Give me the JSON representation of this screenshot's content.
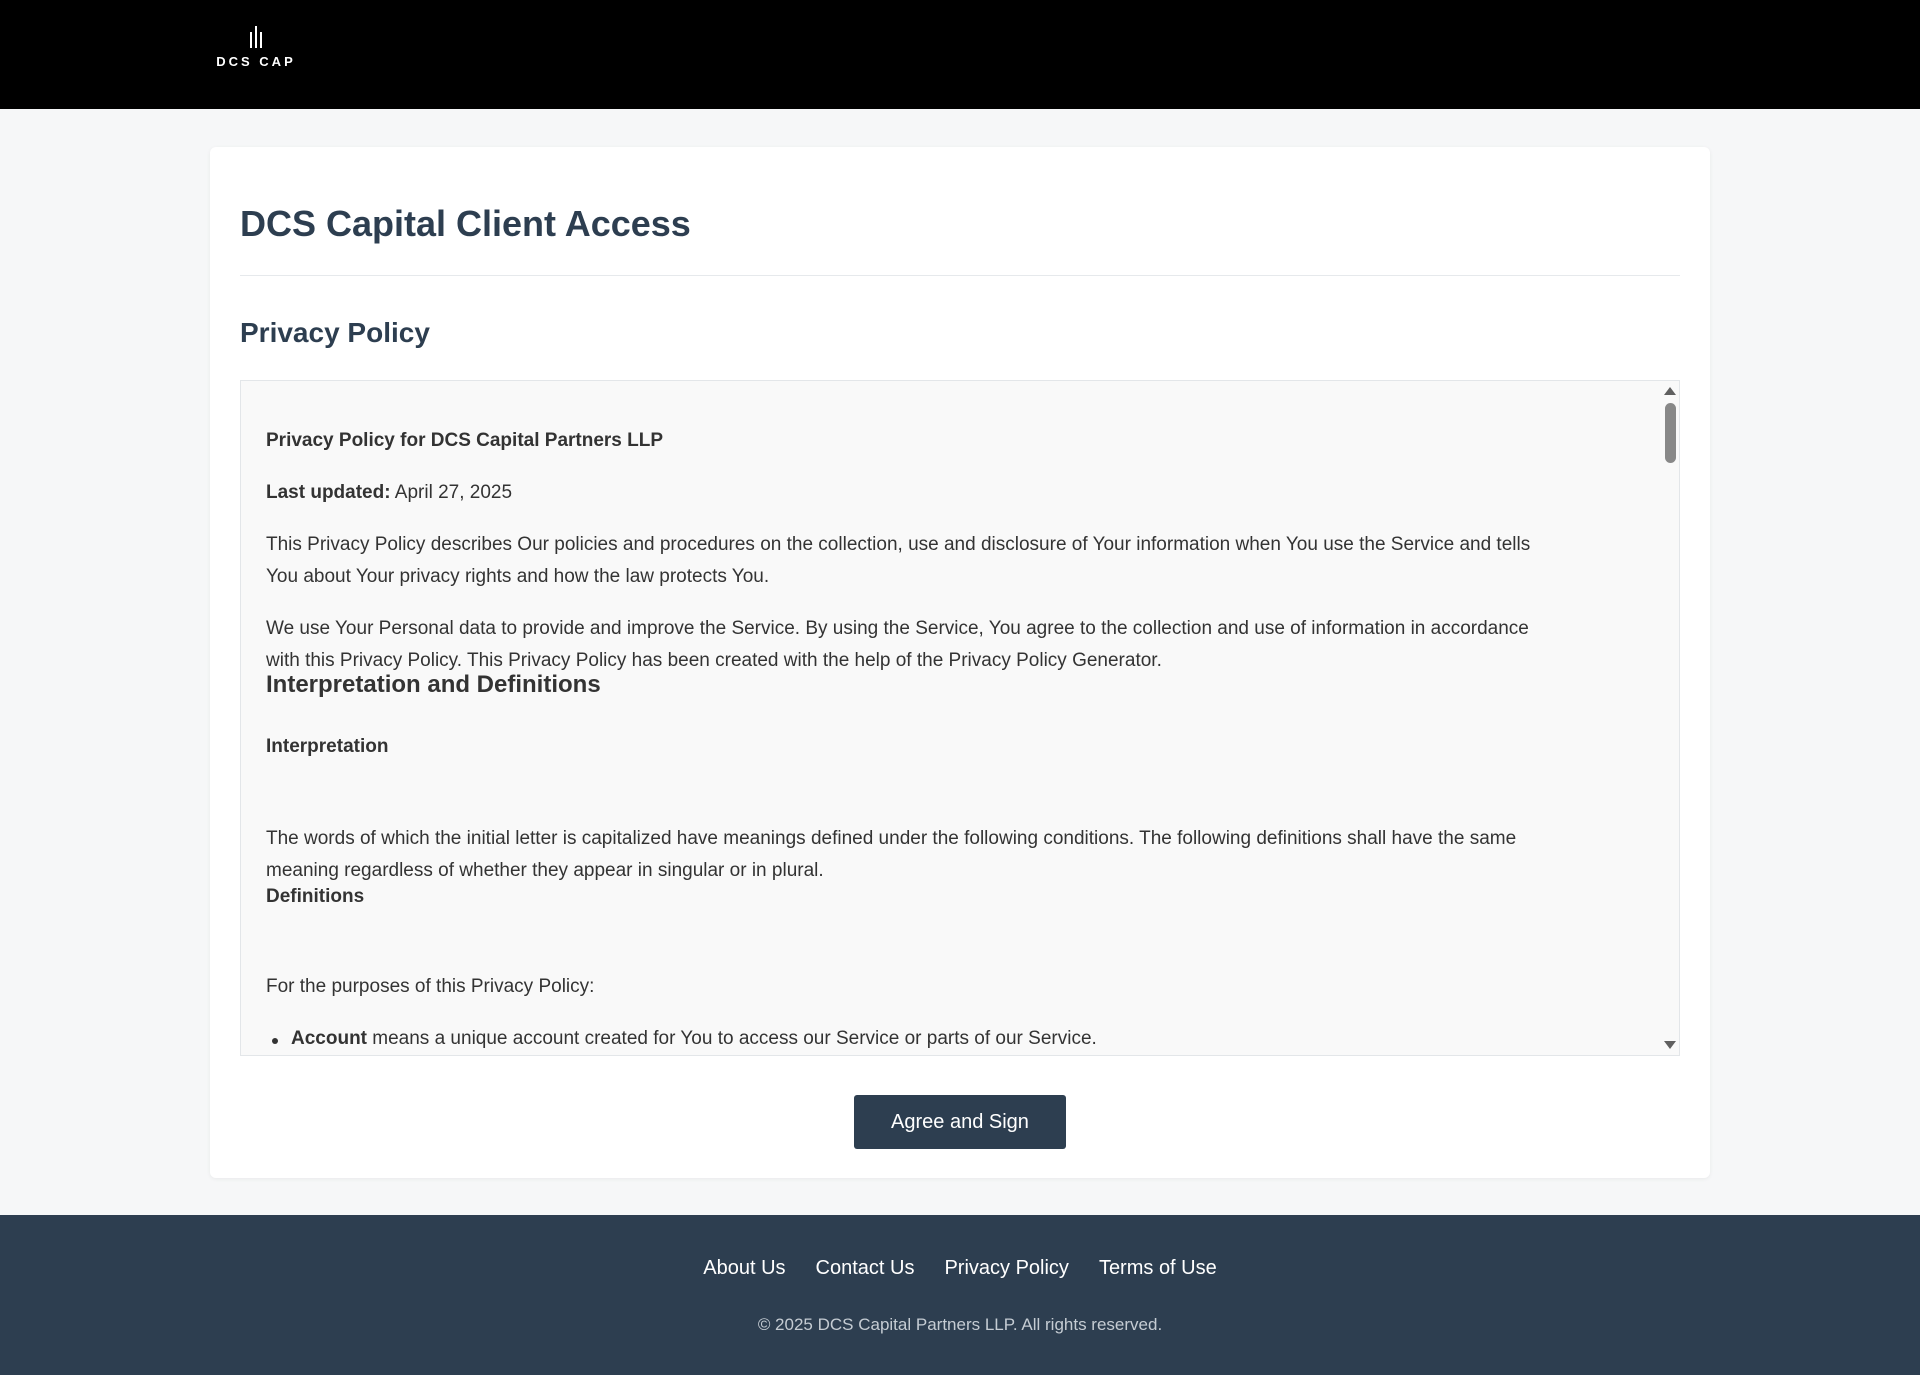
{
  "header": {
    "logo_text": "DCS CAP"
  },
  "main": {
    "title": "DCS Capital Client Access",
    "section_title": "Privacy Policy"
  },
  "policy": {
    "heading": "Privacy Policy for DCS Capital Partners LLP",
    "last_updated_label": "Last updated:",
    "last_updated_value": "April 27, 2025",
    "para1_line1": "This Privacy Policy describes Our policies and procedures on the collection, use and disclosure of Your information when You use the Service and tells",
    "para1_line2": "You about Your privacy rights and how the law protects You.",
    "para2_line1": "We use Your Personal data to provide and improve the Service. By using the Service, You agree to the collection and use of information in accordance",
    "para2_line2": "with this Privacy Policy. This Privacy Policy has been created with the help of the Privacy Policy Generator.",
    "h_interpretation_definitions": "Interpretation and Definitions",
    "h_interpretation": "Interpretation",
    "para3_line1": "The words of which the initial letter is capitalized have meanings defined under the following conditions. The following definitions shall have the same",
    "para3_line2": "meaning regardless of whether they appear in singular or in plural.",
    "h_definitions": "Definitions",
    "para4": "For the purposes of this Privacy Policy:",
    "bullet1_term": "Account",
    "bullet1_text": " means a unique account created for You to access our Service or parts of our Service."
  },
  "actions": {
    "agree_label": "Agree and Sign"
  },
  "footer": {
    "links": [
      "About Us",
      "Contact Us",
      "Privacy Policy",
      "Terms of Use"
    ],
    "copyright": "© 2025 DCS Capital Partners LLP. All rights reserved."
  },
  "colors": {
    "header_bg": "#000000",
    "accent": "#2d3e50",
    "page_bg": "#f6f7f8"
  }
}
